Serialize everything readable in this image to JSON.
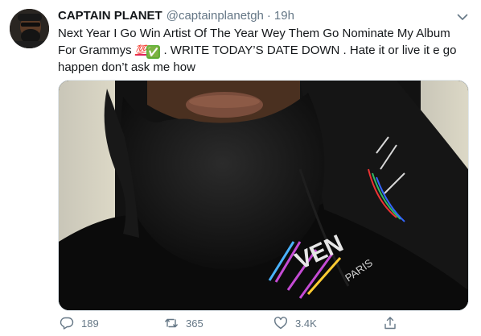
{
  "user": {
    "name": "CAPTAIN PLANET",
    "handle": "@captainplanetgh",
    "separator": "·",
    "time": "19h"
  },
  "tweet": {
    "text_part1": "Next Year I Go Win Artist Of The Year Wey Them Go Nominate My Album For Grammys ",
    "emoji_100": "💯",
    "emoji_check": "✅",
    "text_part2": " . WRITE TODAY’S DATE DOWN . Hate it or live it e go happen don’t ask me how"
  },
  "media": {
    "shirt_print": "VEN",
    "shirt_city": "PARIS"
  },
  "actions": {
    "replies": "189",
    "retweets": "365",
    "likes": "3.4K"
  },
  "icons": {
    "more": "chevron-down-icon",
    "reply": "reply-icon",
    "retweet": "retweet-icon",
    "like": "heart-icon",
    "share": "share-icon"
  },
  "colors": {
    "name": "#14171a",
    "secondary": "#657786",
    "border": "#e1e8ed"
  }
}
